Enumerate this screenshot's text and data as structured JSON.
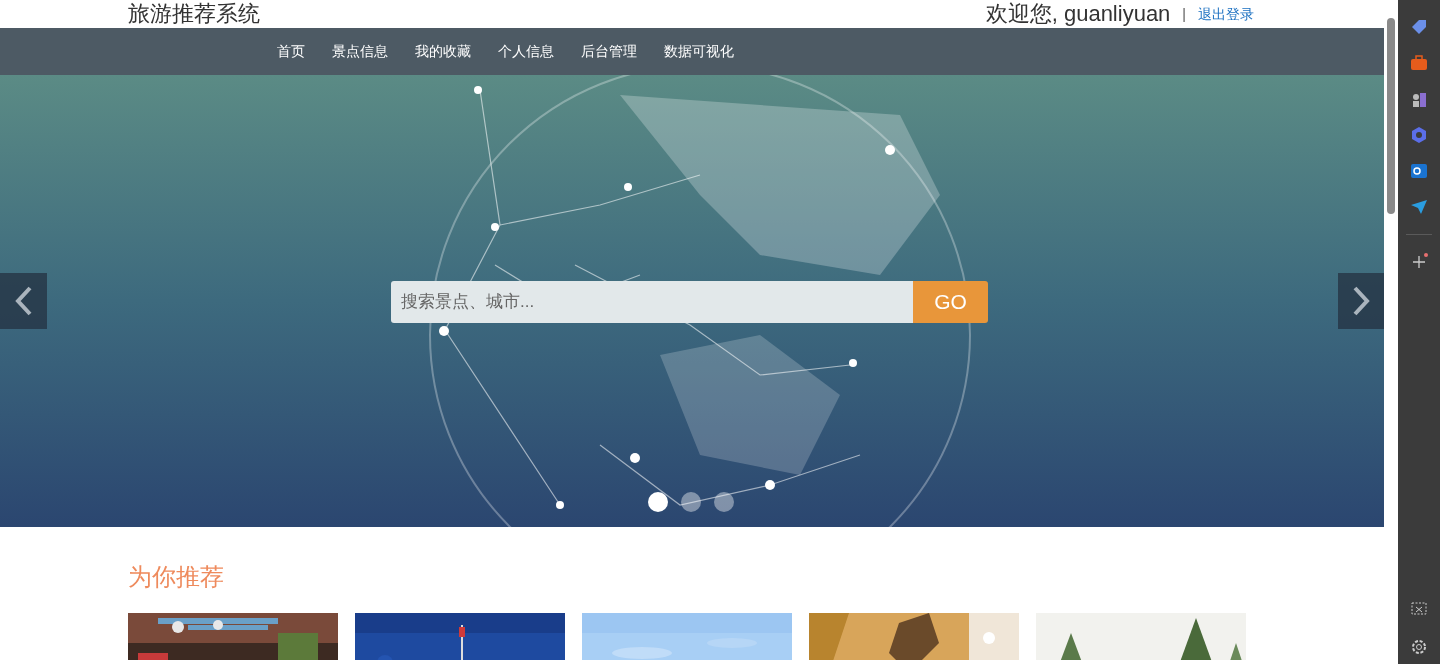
{
  "site_title": "旅游推荐系统",
  "user": {
    "greeting": "欢迎您, guanliyuan",
    "separator": "|",
    "logout": "退出登录"
  },
  "nav": [
    {
      "label": "首页"
    },
    {
      "label": "景点信息"
    },
    {
      "label": "我的收藏"
    },
    {
      "label": "个人信息"
    },
    {
      "label": "后台管理"
    },
    {
      "label": "数据可视化"
    }
  ],
  "banner": {
    "kind": "picture",
    "search": {
      "placeholder": "搜索景点、城市..."
    },
    "go_button": "GO",
    "slides": [
      {
        "selected": true
      },
      {
        "selected": false
      },
      {
        "selected": false
      }
    ]
  },
  "recommend": {
    "title": "为你推荐"
  }
}
